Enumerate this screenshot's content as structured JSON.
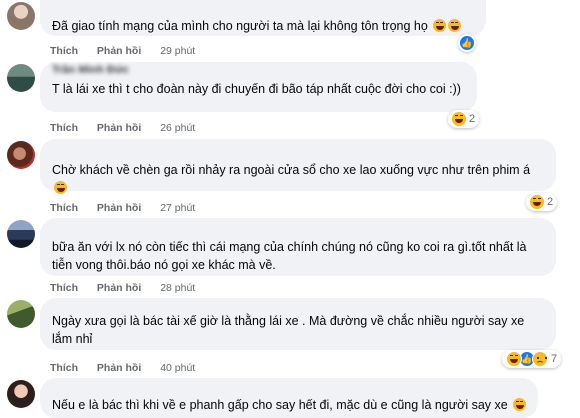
{
  "comments": [
    {
      "author": "",
      "text": "Đã giao tính mạng của mình cho người ta mà lại không tôn trọng họ",
      "like_label": "Thích",
      "reply_label": "Phản hồi",
      "time": "29 phút",
      "reaction_count": ""
    },
    {
      "author": "Trần Minh Đức",
      "text": "T là lái xe thì t cho đoàn này đi chuyến đi bão táp nhất cuộc đời cho coi :))",
      "like_label": "Thích",
      "reply_label": "Phản hồi",
      "time": "26 phút",
      "reaction_count": "2"
    },
    {
      "author": "",
      "text": "Chờ khách về chèn ga rồi nhảy ra ngoài cửa sổ cho xe lao xuống vực như trên phim á",
      "like_label": "Thích",
      "reply_label": "Phản hồi",
      "time": "27 phút",
      "reaction_count": "2"
    },
    {
      "author": "",
      "text_lines": [
        "bữa ăn với lx nó còn tiếc thì cái mạng của chính chúng nó cũng ko coi ra gì.tốt nhất là",
        "tiễn vong thôi.báo nó gọi xe khác mà về."
      ],
      "like_label": "Thích",
      "reply_label": "Phản hồi",
      "time": "28 phút",
      "reaction_count": ""
    },
    {
      "author": "",
      "text_lines": [
        "Ngày xưa gọi là bác tài xế giờ là thằng lái xe . Mà đường về chắc nhiều người say xe",
        "lắm nhỉ"
      ],
      "like_label": "Thích",
      "reply_label": "Phản hồi",
      "time": "40 phút",
      "reaction_count": "7"
    },
    {
      "author": "",
      "text": "Nếu e là bác thì khi về e phanh gấp cho say hết đi, mặc dù e cũng là người say xe"
    }
  ],
  "icons": {
    "haha": "haha-emoji-icon",
    "like": "like-emoji-icon",
    "sad": "sad-emoji-icon"
  },
  "colors": {
    "bubble": "#f0f2f5",
    "meta": "#65676b",
    "like_blue": "#1877f2",
    "emoji_yellow": "#f7b928"
  }
}
